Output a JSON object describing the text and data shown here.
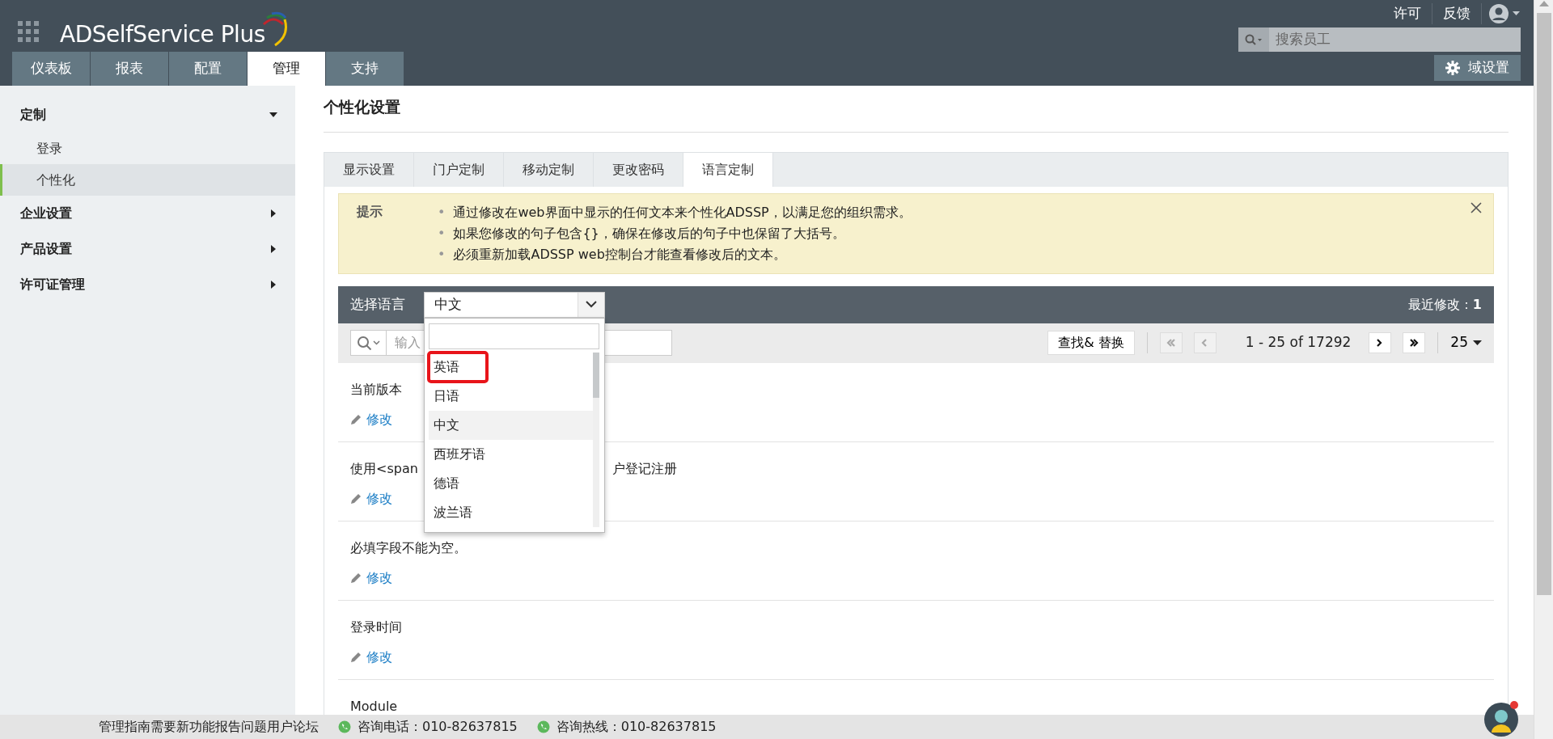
{
  "header": {
    "logo": "ADSelfService Plus",
    "nav_tabs": [
      {
        "label": "仪表板",
        "selected": false
      },
      {
        "label": "报表",
        "selected": false
      },
      {
        "label": "配置",
        "selected": false
      },
      {
        "label": "管理",
        "selected": true
      },
      {
        "label": "支持",
        "selected": false
      }
    ],
    "top_links": [
      "许可",
      "反馈"
    ],
    "search": {
      "placeholder": "搜索员工"
    },
    "domain_button": "域设置"
  },
  "sidebar": {
    "items": [
      {
        "label": "定制",
        "expanded": true,
        "children": [
          {
            "label": "登录",
            "selected": false
          },
          {
            "label": "个性化",
            "selected": true
          }
        ]
      },
      {
        "label": "企业设置",
        "expanded": false
      },
      {
        "label": "产品设置",
        "expanded": false
      },
      {
        "label": "许可证管理",
        "expanded": false
      }
    ]
  },
  "page_title": "个性化设置",
  "tabs": [
    {
      "label": "显示设置",
      "selected": false
    },
    {
      "label": "门户定制",
      "selected": false
    },
    {
      "label": "移动定制",
      "selected": false
    },
    {
      "label": "更改密码",
      "selected": false
    },
    {
      "label": "语言定制",
      "selected": true
    }
  ],
  "hint": {
    "label": "提示",
    "marker": "•",
    "items": [
      "通过修改在web界面中显示的任何文本来个性化ADSSP，以满足您的组织需求。",
      "如果您修改的句子包含{}，确保在修改后的句子中也保留了大括号。",
      "必须重新加载ADSSP web控制台才能查看修改后的文本。"
    ]
  },
  "language_bar": {
    "label": "选择语言",
    "value": "中文",
    "recent_label": "最近修改：",
    "recent_count": "1"
  },
  "toolbar": {
    "search_placeholder": "输入",
    "find_replace": "查找& 替换",
    "range": "1 - 25 of 17292",
    "page_size": "25",
    "pager": [
      {
        "kind": "first",
        "disabled": true
      },
      {
        "kind": "prev",
        "disabled": true
      },
      {
        "kind": "next",
        "disabled": false
      },
      {
        "kind": "last",
        "disabled": false
      }
    ]
  },
  "rows": [
    {
      "texts": [
        "当前版本"
      ],
      "action": "修改"
    },
    {
      "texts": [
        "使用<span",
        "户登记注册"
      ],
      "action": "修改"
    },
    {
      "texts": [
        "必填字段不能为空。"
      ],
      "action": "修改"
    },
    {
      "texts": [
        "登录时间"
      ],
      "action": "修改"
    },
    {
      "texts": [
        "Module"
      ]
    }
  ],
  "dropdown": {
    "options": [
      {
        "label": "英语",
        "selected": false,
        "annotated": true
      },
      {
        "label": "日语",
        "selected": false,
        "annotated": false
      },
      {
        "label": "中文",
        "selected": true,
        "annotated": false
      },
      {
        "label": "西班牙语",
        "selected": false,
        "annotated": false
      },
      {
        "label": "德语",
        "selected": false,
        "annotated": false
      },
      {
        "label": "波兰语",
        "selected": false,
        "annotated": false
      }
    ]
  },
  "footer": {
    "links": [
      "管理指南",
      "需要新功能",
      "报告问题",
      "用户论坛"
    ],
    "phones": [
      "咨询电话：010-82637815",
      "咨询热线：010-82637815"
    ]
  }
}
